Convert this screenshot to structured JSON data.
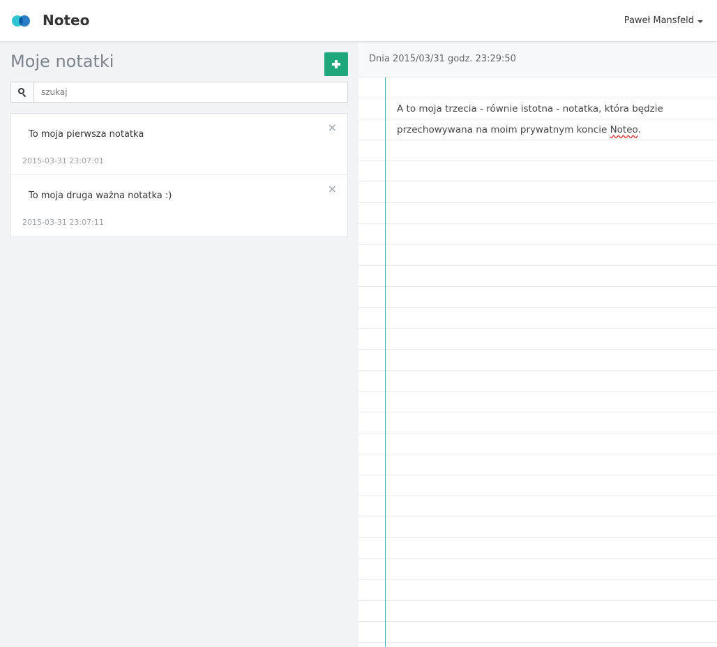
{
  "navbar": {
    "brand": "Noteo",
    "user_name": "Paweł Mansfeld"
  },
  "sidebar": {
    "title": "Moje notatki",
    "search_placeholder": "szukaj",
    "notes": [
      {
        "text": "To moja pierwsza notatka",
        "date": "2015-03-31 23:07:01"
      },
      {
        "text": "To moja druga ważna notatka :)",
        "date": "2015-03-31 23:07:11"
      }
    ]
  },
  "editor": {
    "date_label": "Dnia 2015/03/31 godz. 23:29:50",
    "content_before": "A to moja trzecia - równie istotna - notatka, która będzie przechowywana na moim prywatnym koncie ",
    "content_highlight": "Noteo",
    "content_after": "."
  },
  "colors": {
    "add_button": "#1fa67a",
    "margin_line": "#3bb2c4",
    "logo_left": "#2fc4d2",
    "logo_right": "#2a7cc6"
  },
  "icons": {
    "add": "plus-icon",
    "search": "search-icon",
    "close": "close-icon",
    "user_menu": "caret-down-icon",
    "logo": "logo-icon"
  }
}
